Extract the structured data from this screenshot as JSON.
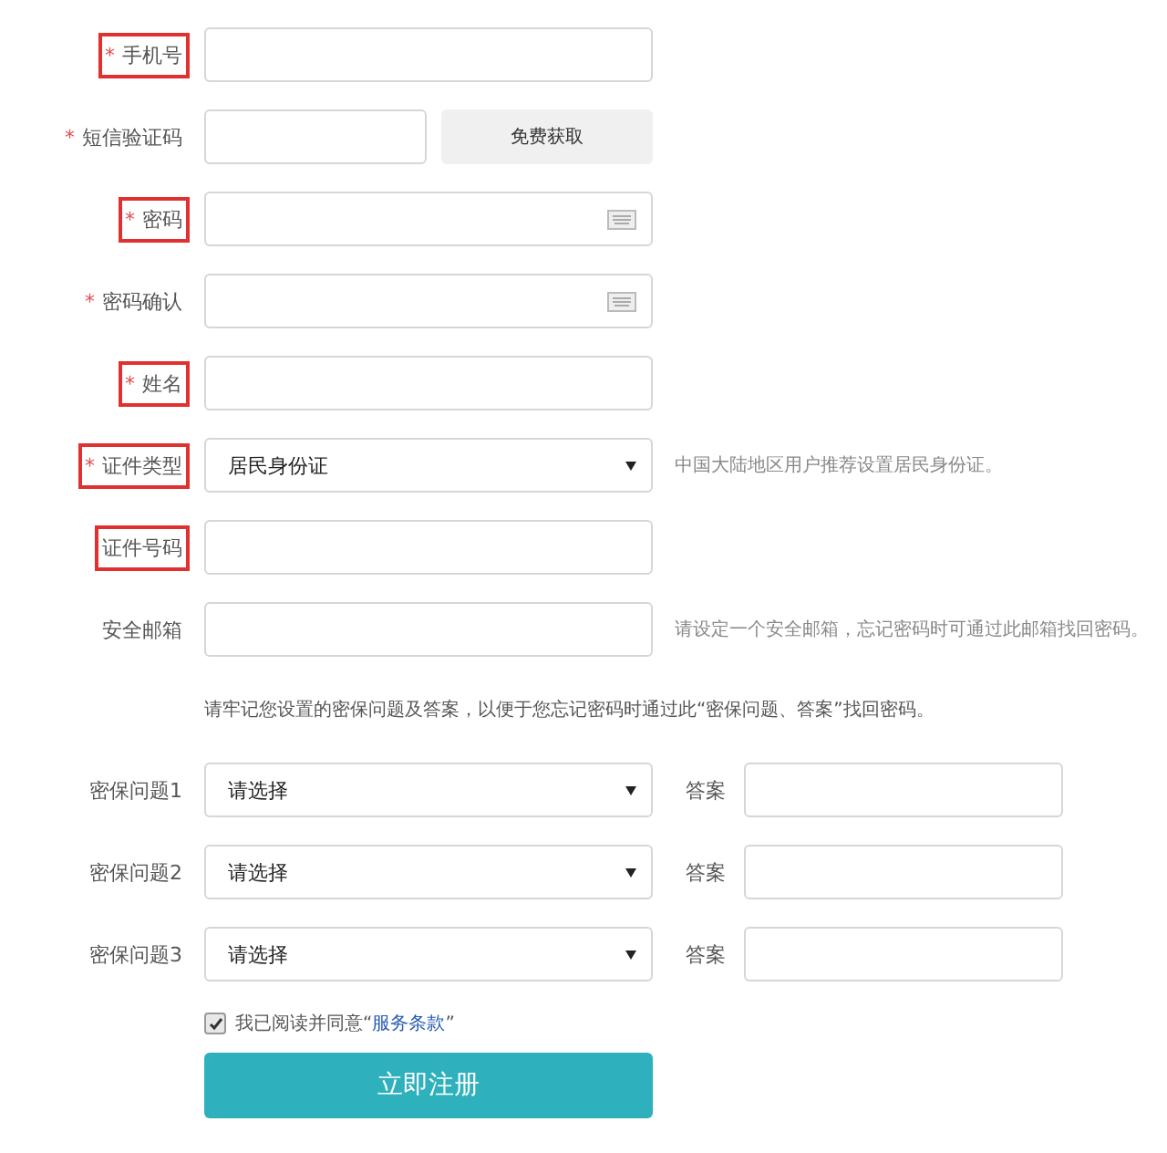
{
  "fields": [
    {
      "kind": "text",
      "mark": "*",
      "label": "手机号",
      "highlighted": true
    },
    {
      "kind": "sms",
      "mark": "*",
      "label": "短信验证码",
      "highlighted": false,
      "button": "免费获取"
    },
    {
      "kind": "password",
      "mark": "*",
      "label": "密码",
      "highlighted": true
    },
    {
      "kind": "password",
      "mark": "*",
      "label": "密码确认",
      "highlighted": false
    },
    {
      "kind": "text",
      "mark": "*",
      "label": "姓名",
      "highlighted": true
    },
    {
      "kind": "select",
      "mark": "*",
      "label": "证件类型",
      "highlighted": true,
      "value": "居民身份证",
      "hint": "中国大陆地区用户推荐设置居民身份证。"
    },
    {
      "kind": "text",
      "label": "证件号码",
      "highlighted": true
    },
    {
      "kind": "text",
      "label": "安全邮箱",
      "highlighted": false,
      "hint": "请设定一个安全邮箱，忘记密码时可通过此邮箱找回密码。"
    }
  ],
  "security_note": "请牢记您设置的密保问题及答案，以便于您忘记密码时通过此“密保问题、答案”找回密码。",
  "questions": [
    {
      "label": "密保问题1",
      "value": "请选择",
      "answer_label": "答案"
    },
    {
      "label": "密保问题2",
      "value": "请选择",
      "answer_label": "答案"
    },
    {
      "label": "密保问题3",
      "value": "请选择",
      "answer_label": "答案"
    }
  ],
  "agreement": {
    "checked": true,
    "text": "我已阅读并同意“",
    "link": "服务条款",
    "end": "”"
  },
  "submit": "立即注册"
}
